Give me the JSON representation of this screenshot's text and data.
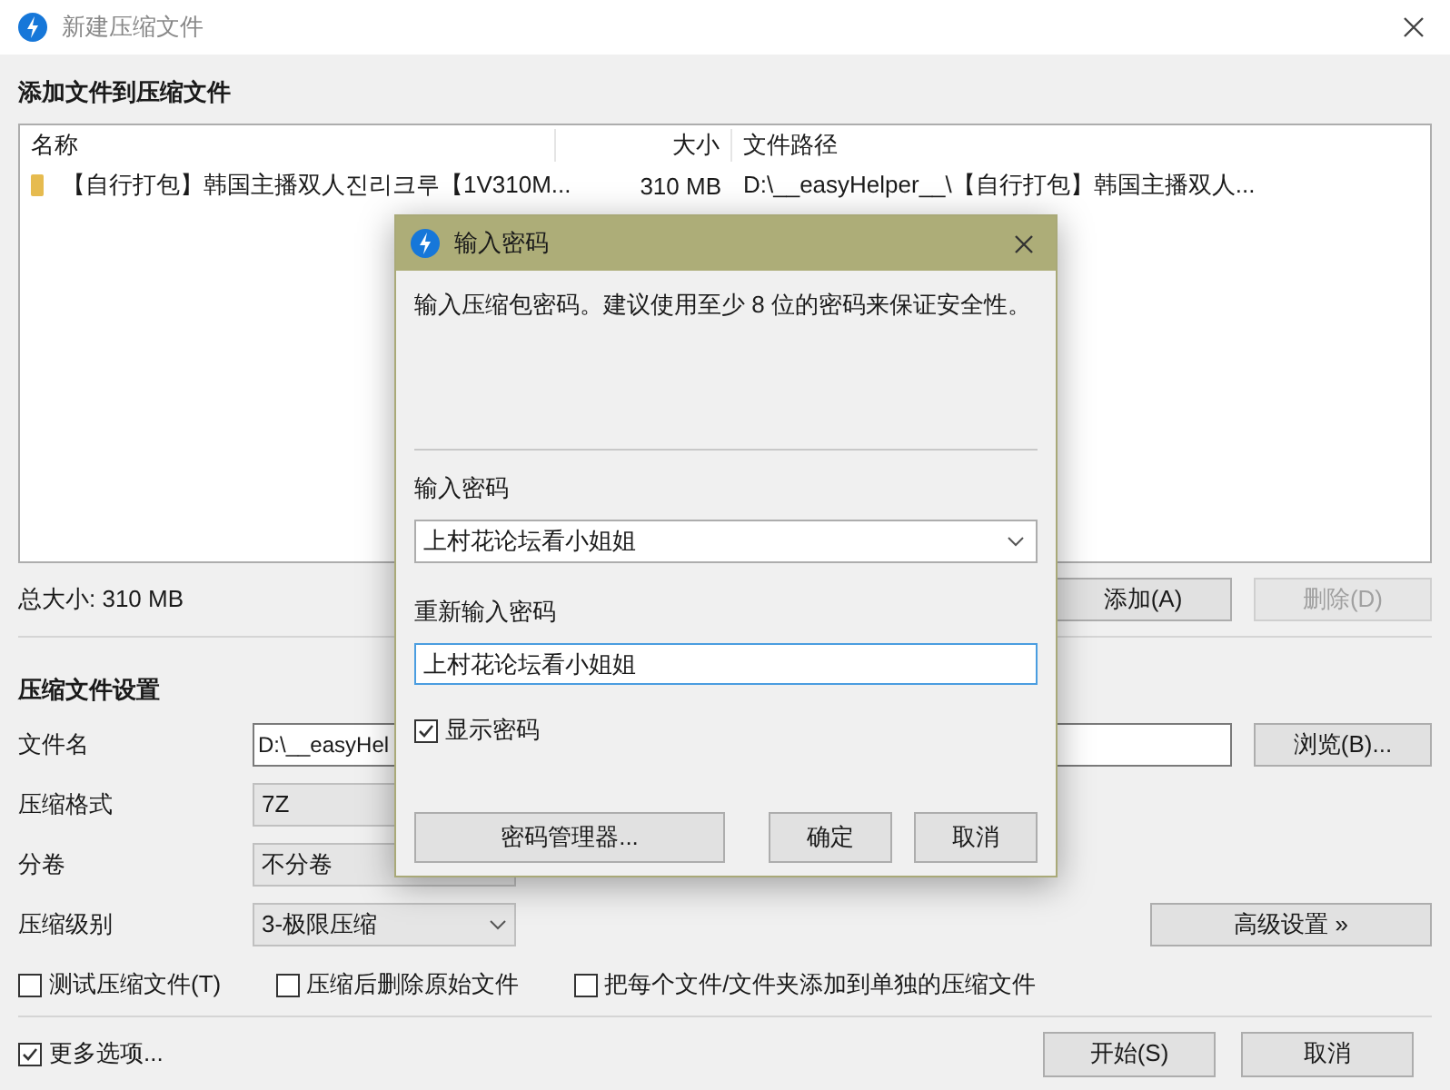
{
  "window": {
    "title": "新建压缩文件"
  },
  "files_section": {
    "heading": "添加文件到压缩文件",
    "columns": [
      "名称",
      "大小",
      "文件路径"
    ],
    "rows": [
      {
        "name": "【自行打包】韩国主播双人진리크루【1V310M...",
        "size": "310 MB",
        "path": "D:\\__easyHelper__\\【自行打包】韩国主播双人..."
      }
    ],
    "total": "总大小: 310 MB",
    "buttons": [
      {
        "label": "添加(A)",
        "disabled": false
      },
      {
        "label": "删除(D)",
        "disabled": true
      }
    ]
  },
  "settings": {
    "heading": "压缩文件设置",
    "filename": {
      "label": "文件名",
      "value": "D:\\__easyHel"
    },
    "browse": "浏览(B)...",
    "selects": [
      {
        "label": "压缩格式",
        "value": "7Z"
      },
      {
        "label": "分卷",
        "value": "不分卷"
      },
      {
        "label": "压缩级别",
        "value": "3-极限压缩"
      }
    ],
    "advanced": "高级设置 »",
    "options": [
      {
        "label": "测试压缩文件(T)",
        "checked": false
      },
      {
        "label": "压缩后删除原始文件",
        "checked": false
      },
      {
        "label": "把每个文件/文件夹添加到单独的压缩文件",
        "checked": false
      }
    ]
  },
  "footer": {
    "more": {
      "label": "更多选项...",
      "checked": true
    },
    "buttons": [
      "开始(S)",
      "取消"
    ]
  },
  "dialog": {
    "title": "输入密码",
    "message": "输入压缩包密码。建议使用至少 8 位的密码来保证安全性。",
    "password": {
      "label": "输入密码",
      "value": "上村花论坛看小姐姐"
    },
    "confirm": {
      "label": "重新输入密码",
      "value": "上村花论坛看小姐姐"
    },
    "show_password": {
      "label": "显示密码",
      "checked": true
    },
    "manager": "密码管理器...",
    "buttons": [
      "确定",
      "取消"
    ]
  }
}
